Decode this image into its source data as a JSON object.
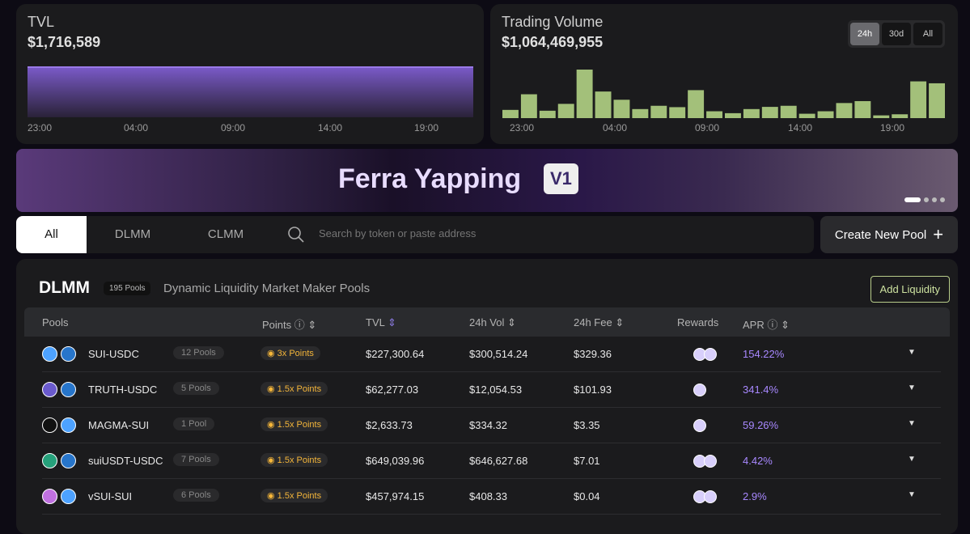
{
  "tvl": {
    "title": "TVL",
    "value": "$1,716,589",
    "ticks": [
      "23:00",
      "04:00",
      "09:00",
      "14:00",
      "19:00"
    ],
    "color": "#8a6ad8"
  },
  "volume": {
    "title": "Trading Volume",
    "value": "$1,064,469,955",
    "ranges": [
      "24h",
      "30d",
      "All"
    ],
    "selected_range": "24h",
    "ticks": [
      "23:00",
      "04:00",
      "09:00",
      "14:00",
      "19:00"
    ]
  },
  "chart_data": [
    {
      "type": "area",
      "title": "TVL",
      "x": [
        "23:00",
        "04:00",
        "09:00",
        "14:00",
        "19:00"
      ],
      "values": [
        1716589,
        1716589,
        1716589,
        1716589,
        1716589
      ]
    },
    {
      "type": "bar",
      "title": "Trading Volume",
      "unit": "relative",
      "values": [
        30,
        87,
        27,
        52,
        177,
        97,
        67,
        33,
        45,
        40,
        102,
        25,
        18,
        33,
        41,
        45,
        16,
        25,
        55,
        62,
        10,
        14,
        134,
        127
      ],
      "color": "#a3c07a"
    }
  ],
  "banner": {
    "title": "Ferra Yapping",
    "badge": "V1",
    "slides": 4,
    "active_slide": 0
  },
  "filter": {
    "tabs": [
      "All",
      "DLMM",
      "CLMM"
    ],
    "active": "All",
    "search_placeholder": "Search by token or paste address"
  },
  "create_label": "Create New Pool",
  "create_icon": "+",
  "section": {
    "title": "DLMM",
    "count": "195 Pools",
    "desc": "Dynamic Liquidity Market Maker Pools",
    "add_label": "Add Liquidity"
  },
  "columns": [
    "Pools",
    "Points",
    "TVL",
    "24h Vol",
    "24h Fee",
    "Rewards",
    "APR"
  ],
  "rows": [
    {
      "pair": "SUI-USDC",
      "pools": "12 Pools",
      "points": "3x Points",
      "tvl": "$227,300.64",
      "vol": "$300,514.24",
      "fee": "$329.36",
      "apr": "154.22%",
      "c1": "#4da2ff",
      "c2": "#2775ca",
      "rewards": 2
    },
    {
      "pair": "TRUTH-USDC",
      "pools": "5 Pools",
      "points": "1.5x Points",
      "tvl": "$62,277.03",
      "vol": "$12,054.53",
      "fee": "$101.93",
      "apr": "341.4%",
      "c1": "#6a5acd",
      "c2": "#2775ca",
      "rewards": 1
    },
    {
      "pair": "MAGMA-SUI",
      "pools": "1 Pool",
      "points": "1.5x Points",
      "tvl": "$2,633.73",
      "vol": "$334.32",
      "fee": "$3.35",
      "apr": "59.26%",
      "c1": "#111111",
      "c2": "#4da2ff",
      "rewards": 1
    },
    {
      "pair": "suiUSDT-USDC",
      "pools": "7 Pools",
      "points": "1.5x Points",
      "tvl": "$649,039.96",
      "vol": "$646,627.68",
      "fee": "$7.01",
      "apr": "4.42%",
      "c1": "#26a17b",
      "c2": "#2775ca",
      "rewards": 2
    },
    {
      "pair": "vSUI-SUI",
      "pools": "6 Pools",
      "points": "1.5x Points",
      "tvl": "$457,974.15",
      "vol": "$408.33",
      "fee": "$0.04",
      "apr": "2.9%",
      "c1": "#c070e0",
      "c2": "#4da2ff",
      "rewards": 2
    }
  ]
}
